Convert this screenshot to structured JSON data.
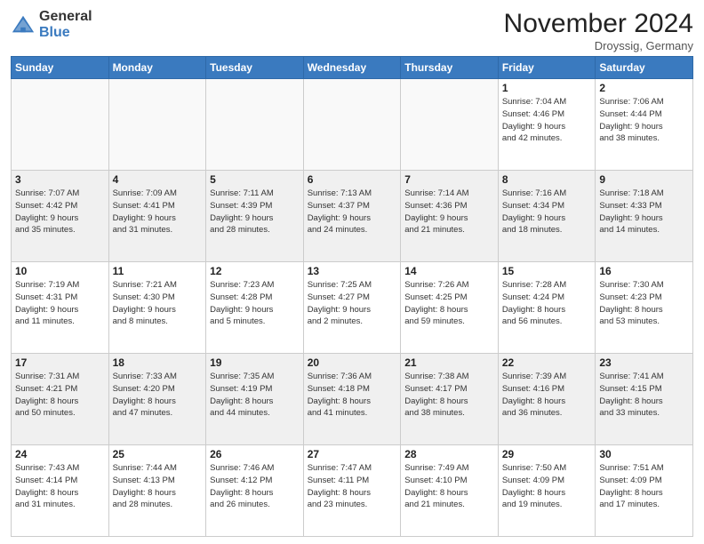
{
  "header": {
    "logo_line1": "General",
    "logo_line2": "Blue",
    "month_title": "November 2024",
    "location": "Droyssig, Germany"
  },
  "weekdays": [
    "Sunday",
    "Monday",
    "Tuesday",
    "Wednesday",
    "Thursday",
    "Friday",
    "Saturday"
  ],
  "weeks": [
    [
      {
        "day": "",
        "info": ""
      },
      {
        "day": "",
        "info": ""
      },
      {
        "day": "",
        "info": ""
      },
      {
        "day": "",
        "info": ""
      },
      {
        "day": "",
        "info": ""
      },
      {
        "day": "1",
        "info": "Sunrise: 7:04 AM\nSunset: 4:46 PM\nDaylight: 9 hours\nand 42 minutes."
      },
      {
        "day": "2",
        "info": "Sunrise: 7:06 AM\nSunset: 4:44 PM\nDaylight: 9 hours\nand 38 minutes."
      }
    ],
    [
      {
        "day": "3",
        "info": "Sunrise: 7:07 AM\nSunset: 4:42 PM\nDaylight: 9 hours\nand 35 minutes."
      },
      {
        "day": "4",
        "info": "Sunrise: 7:09 AM\nSunset: 4:41 PM\nDaylight: 9 hours\nand 31 minutes."
      },
      {
        "day": "5",
        "info": "Sunrise: 7:11 AM\nSunset: 4:39 PM\nDaylight: 9 hours\nand 28 minutes."
      },
      {
        "day": "6",
        "info": "Sunrise: 7:13 AM\nSunset: 4:37 PM\nDaylight: 9 hours\nand 24 minutes."
      },
      {
        "day": "7",
        "info": "Sunrise: 7:14 AM\nSunset: 4:36 PM\nDaylight: 9 hours\nand 21 minutes."
      },
      {
        "day": "8",
        "info": "Sunrise: 7:16 AM\nSunset: 4:34 PM\nDaylight: 9 hours\nand 18 minutes."
      },
      {
        "day": "9",
        "info": "Sunrise: 7:18 AM\nSunset: 4:33 PM\nDaylight: 9 hours\nand 14 minutes."
      }
    ],
    [
      {
        "day": "10",
        "info": "Sunrise: 7:19 AM\nSunset: 4:31 PM\nDaylight: 9 hours\nand 11 minutes."
      },
      {
        "day": "11",
        "info": "Sunrise: 7:21 AM\nSunset: 4:30 PM\nDaylight: 9 hours\nand 8 minutes."
      },
      {
        "day": "12",
        "info": "Sunrise: 7:23 AM\nSunset: 4:28 PM\nDaylight: 9 hours\nand 5 minutes."
      },
      {
        "day": "13",
        "info": "Sunrise: 7:25 AM\nSunset: 4:27 PM\nDaylight: 9 hours\nand 2 minutes."
      },
      {
        "day": "14",
        "info": "Sunrise: 7:26 AM\nSunset: 4:25 PM\nDaylight: 8 hours\nand 59 minutes."
      },
      {
        "day": "15",
        "info": "Sunrise: 7:28 AM\nSunset: 4:24 PM\nDaylight: 8 hours\nand 56 minutes."
      },
      {
        "day": "16",
        "info": "Sunrise: 7:30 AM\nSunset: 4:23 PM\nDaylight: 8 hours\nand 53 minutes."
      }
    ],
    [
      {
        "day": "17",
        "info": "Sunrise: 7:31 AM\nSunset: 4:21 PM\nDaylight: 8 hours\nand 50 minutes."
      },
      {
        "day": "18",
        "info": "Sunrise: 7:33 AM\nSunset: 4:20 PM\nDaylight: 8 hours\nand 47 minutes."
      },
      {
        "day": "19",
        "info": "Sunrise: 7:35 AM\nSunset: 4:19 PM\nDaylight: 8 hours\nand 44 minutes."
      },
      {
        "day": "20",
        "info": "Sunrise: 7:36 AM\nSunset: 4:18 PM\nDaylight: 8 hours\nand 41 minutes."
      },
      {
        "day": "21",
        "info": "Sunrise: 7:38 AM\nSunset: 4:17 PM\nDaylight: 8 hours\nand 38 minutes."
      },
      {
        "day": "22",
        "info": "Sunrise: 7:39 AM\nSunset: 4:16 PM\nDaylight: 8 hours\nand 36 minutes."
      },
      {
        "day": "23",
        "info": "Sunrise: 7:41 AM\nSunset: 4:15 PM\nDaylight: 8 hours\nand 33 minutes."
      }
    ],
    [
      {
        "day": "24",
        "info": "Sunrise: 7:43 AM\nSunset: 4:14 PM\nDaylight: 8 hours\nand 31 minutes."
      },
      {
        "day": "25",
        "info": "Sunrise: 7:44 AM\nSunset: 4:13 PM\nDaylight: 8 hours\nand 28 minutes."
      },
      {
        "day": "26",
        "info": "Sunrise: 7:46 AM\nSunset: 4:12 PM\nDaylight: 8 hours\nand 26 minutes."
      },
      {
        "day": "27",
        "info": "Sunrise: 7:47 AM\nSunset: 4:11 PM\nDaylight: 8 hours\nand 23 minutes."
      },
      {
        "day": "28",
        "info": "Sunrise: 7:49 AM\nSunset: 4:10 PM\nDaylight: 8 hours\nand 21 minutes."
      },
      {
        "day": "29",
        "info": "Sunrise: 7:50 AM\nSunset: 4:09 PM\nDaylight: 8 hours\nand 19 minutes."
      },
      {
        "day": "30",
        "info": "Sunrise: 7:51 AM\nSunset: 4:09 PM\nDaylight: 8 hours\nand 17 minutes."
      }
    ]
  ]
}
